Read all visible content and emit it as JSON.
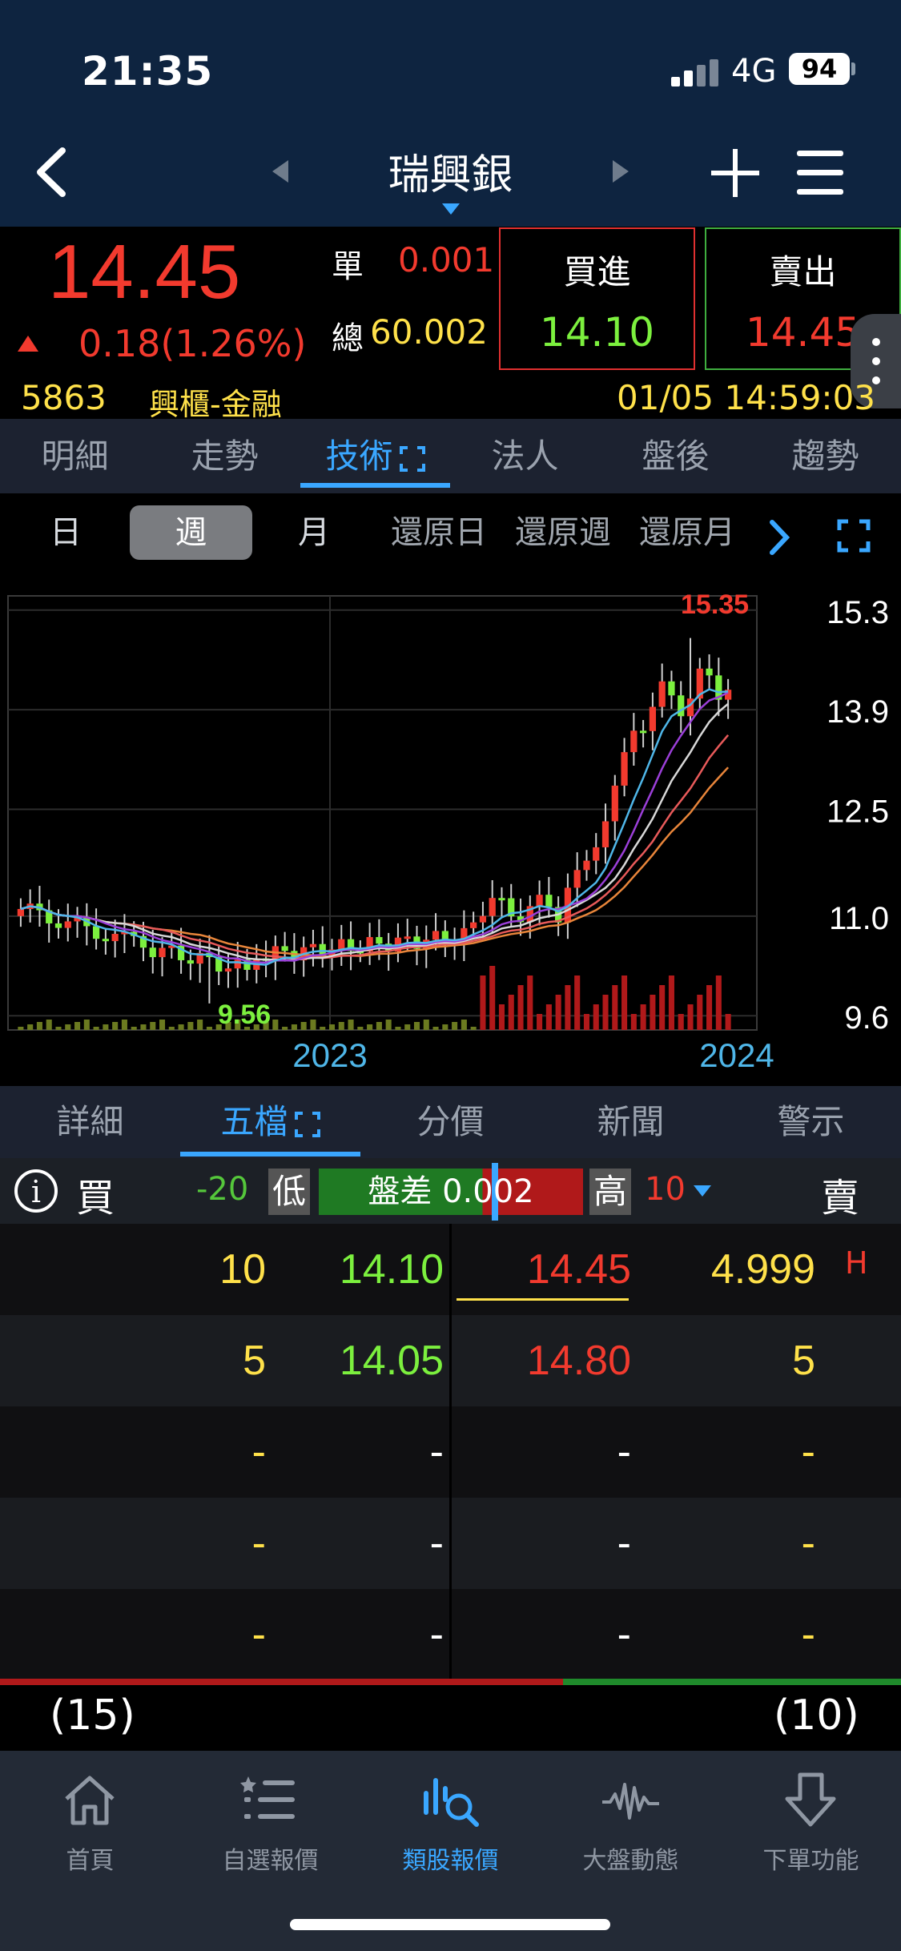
{
  "status": {
    "time": "21:35",
    "network": "4G",
    "battery": "94"
  },
  "header": {
    "stock_name": "瑞興銀"
  },
  "quote": {
    "last": "14.45",
    "change": "0.18(1.26%)",
    "unit_label": "單",
    "unit_value": "0.001",
    "total_label": "總",
    "total_value": "60.002",
    "bid_label": "買進",
    "bid_price": "14.10",
    "ask_label": "賣出",
    "ask_price": "14.45",
    "code": "5863",
    "sector": "興櫃-金融",
    "timestamp": "01/05 14:59:03"
  },
  "main_tabs": [
    "明細",
    "走勢",
    "技術",
    "法人",
    "盤後",
    "趨勢"
  ],
  "period_tabs": [
    "日",
    "週",
    "月",
    "還原日",
    "還原週",
    "還原月"
  ],
  "chart_data": {
    "type": "candlestick",
    "period": "週",
    "y_ticks": [
      "15.3",
      "13.9",
      "12.5",
      "11.0",
      "9.6"
    ],
    "ylim": [
      9.4,
      15.5
    ],
    "x_ticks": [
      "2023",
      "2024"
    ],
    "high_label": "15.35",
    "low_label": "9.56",
    "colors": {
      "up": "#f23a2e",
      "down": "#7cf03e",
      "ma1": "#4fb6e8",
      "ma2": "#9b3fd8",
      "ma3": "#d8d8d8",
      "ma4": "#e85a5a",
      "ma5": "#e8853a"
    }
  },
  "lower_tabs": [
    "詳細",
    "五檔",
    "分價",
    "新聞",
    "警示"
  ],
  "spread": {
    "buy_label": "買",
    "sell_label": "賣",
    "low_value": "-20",
    "low_label": "低",
    "text": "盤差 0.002",
    "high_label": "高",
    "high_value": "10"
  },
  "order_book": [
    {
      "bid_vol": "10",
      "bid": "14.10",
      "ask": "14.45",
      "ask_vol": "4.999"
    },
    {
      "bid_vol": "5",
      "bid": "14.05",
      "ask": "14.80",
      "ask_vol": "5"
    },
    {
      "bid_vol": "-",
      "bid": "-",
      "ask": "-",
      "ask_vol": "-"
    },
    {
      "bid_vol": "-",
      "bid": "-",
      "ask": "-",
      "ask_vol": "-"
    },
    {
      "bid_vol": "-",
      "bid": "-",
      "ask": "-",
      "ask_vol": "-"
    }
  ],
  "order_flag": "H",
  "totals": {
    "buy": "(15)",
    "sell": "(10)"
  },
  "bottom_nav": [
    "首頁",
    "自選報價",
    "類股報價",
    "大盤動態",
    "下單功能"
  ]
}
